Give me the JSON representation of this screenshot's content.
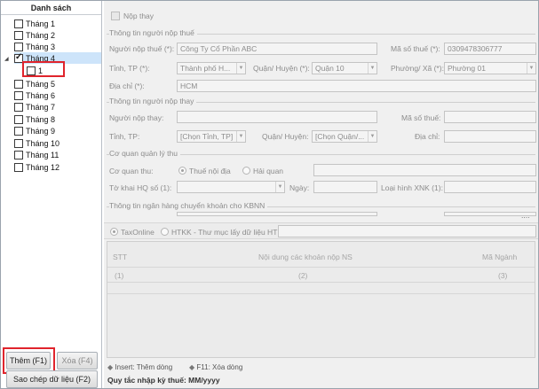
{
  "left_panel": {
    "title": "Danh sách",
    "months": [
      "Tháng 1",
      "Tháng 2",
      "Tháng 3",
      "Tháng 4",
      "Tháng 5",
      "Tháng 6",
      "Tháng 7",
      "Tháng 8",
      "Tháng 9",
      "Tháng 10",
      "Tháng 11",
      "Tháng 12"
    ],
    "child_item": "1",
    "add_button": "Thêm (F1)",
    "delete_button": "Xóa (F4)",
    "copy_button": "Sao chép dữ liệu (F2)"
  },
  "form": {
    "pay_on_behalf_label": "Nộp thay",
    "taxpayer_section": "Thông tin người nộp thuế",
    "taxpayer_name_label": "Người nộp thuế (*):",
    "taxpayer_name_value": "Công Ty Cổ Phần ABC",
    "tax_code_label": "Mã số thuế (*):",
    "tax_code_value": "0309478306777",
    "province_label": "Tỉnh, TP (*):",
    "province_value": "Thành phố H...",
    "district_label": "Quận/ Huyện (*):",
    "district_value": "Quận 10",
    "ward_label": "Phường/ Xã (*):",
    "ward_value": "Phường 01",
    "address_label": "Địa chỉ (*):",
    "address_value": "HCM",
    "payer_section": "Thông tin người nộp thay",
    "payer_label": "Người nộp thay:",
    "payer_tax_code_label": "Mã số thuế:",
    "payer_province_label": "Tỉnh, TP:",
    "payer_province_value": "[Chọn Tỉnh, TP]",
    "payer_district_label": "Quận/ Huyện:",
    "payer_district_value": "[Chọn Quận/...",
    "payer_address_label": "Địa chỉ:",
    "agency_section": "Cơ quan quản lý thu",
    "agency_label": "Cơ quan thu:",
    "agency_option_1": "Thuế nội địa",
    "agency_option_2": "Hải quan",
    "customs_decl_label": "Tờ khai HQ số (1):",
    "date_label": "Ngày:",
    "xnk_label": "Loại hình XNK (1):",
    "bank_section": "Thông tin ngân hàng chuyển khoản cho KBNN",
    "bank_dots": "....",
    "taxonline_label": "TaxOnline",
    "htkk_label": "HTKK - Thư mục lấy dữ liệu HTKK"
  },
  "grid": {
    "col_stt": "STT",
    "col_content": "Nội dung các khoản nộp NS",
    "col_code": "Mã Ngành",
    "row_stt": "(1)",
    "row_content": "(2)",
    "row_code": "(3)"
  },
  "status": {
    "insert_hint": "Insert: Thêm dòng",
    "f11_hint": "F11: Xóa dòng",
    "date_rule": "Quy tắc nhập kỳ thuế: MM/yyyy"
  }
}
